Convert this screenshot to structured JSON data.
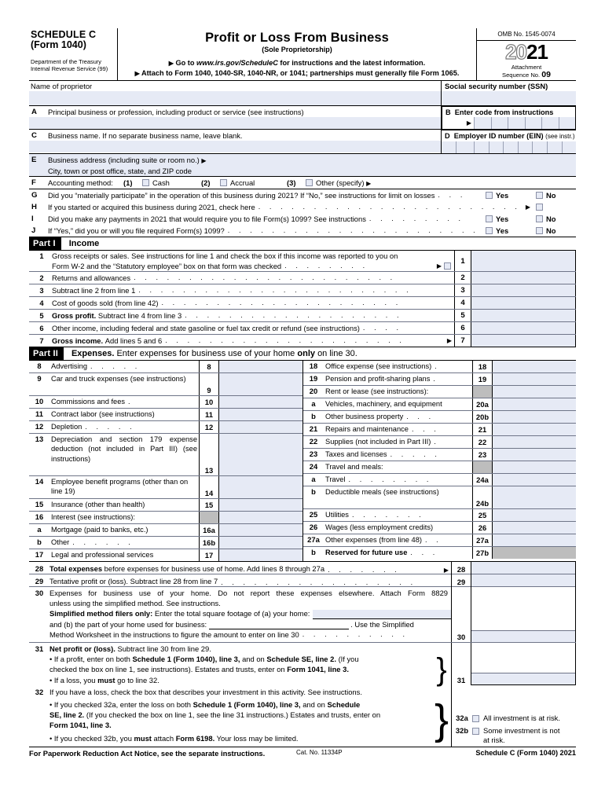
{
  "header": {
    "schedule_line1": "SCHEDULE C",
    "schedule_line2": "(Form 1040)",
    "dept_line1": "Department of the Treasury",
    "dept_line2": "Internal Revenue Service (99)",
    "title": "Profit or Loss From Business",
    "subtitle": "(Sole Proprietorship)",
    "goto_prefix": "Go to",
    "goto_url": "www.irs.gov/ScheduleC",
    "goto_suffix": "for instructions and the latest information.",
    "attach": "Attach to Form 1040, 1040-SR, 1040-NR, or 1041; partnerships must generally file Form 1065.",
    "omb": "OMB No. 1545-0074",
    "year_light": "20",
    "year_bold": "21",
    "attachment_label": "Attachment",
    "sequence_label": "Sequence No.",
    "sequence_no": "09"
  },
  "identity": {
    "name_label": "Name of proprietor",
    "ssn_label": "Social security number (SSN)",
    "a_letter": "A",
    "a_text": "Principal business or profession, including product or service (see instructions)",
    "b_letter": "B",
    "b_text": "Enter code from instructions",
    "c_letter": "C",
    "c_text": "Business name. If no separate business name, leave blank.",
    "d_letter": "D",
    "d_text": "Employer ID number (EIN)",
    "d_text_small": "(see instr.)",
    "e_letter": "E",
    "e_text": "Business address (including suite or room no.)",
    "e_text2": "City, town or post office, state, and ZIP code",
    "f_letter": "F",
    "f_label": "Accounting method:",
    "f_opt1_num": "(1)",
    "f_opt1": "Cash",
    "f_opt2_num": "(2)",
    "f_opt2": "Accrual",
    "f_opt3_num": "(3)",
    "f_opt3": "Other (specify)",
    "g_letter": "G",
    "g_text": "Did you “materially participate” in the operation of this business during 2021? If “No,” see instructions for limit on losses",
    "h_letter": "H",
    "h_text": "If you started or acquired this business during 2021, check here",
    "i_letter": "I",
    "i_text": "Did you make any payments in 2021 that would require you to file Form(s) 1099? See instructions",
    "j_letter": "J",
    "j_text": "If “Yes,” did you or will you file required Form(s) 1099?",
    "yes": "Yes",
    "no": "No"
  },
  "part1": {
    "part_label": "Part I",
    "part_title": "Income",
    "lines": [
      {
        "num": "1",
        "text_a": "Gross receipts or sales. See instructions for line 1 and check the box if this income was reported to you on",
        "text_b": "Form W-2 and the “Statutory employee” box on that form was checked",
        "has_checkbox": true
      },
      {
        "num": "2",
        "text_a": "Returns and allowances"
      },
      {
        "num": "3",
        "text_a": "Subtract line 2 from line 1"
      },
      {
        "num": "4",
        "text_a": "Cost of goods sold (from line 42)"
      },
      {
        "num": "5",
        "text_bold": "Gross profit.",
        "text_a": "Subtract line 4 from line 3"
      },
      {
        "num": "6",
        "text_a": "Other income, including federal and state gasoline or fuel tax credit or refund (see instructions)"
      },
      {
        "num": "7",
        "text_bold": "Gross income.",
        "text_a": "Add lines 5 and 6"
      }
    ]
  },
  "part2": {
    "part_label": "Part II",
    "part_title_bold": "Expenses.",
    "part_title_rest": "Enter expenses for business use of your home",
    "part_title_only": "only",
    "part_title_end": "on line 30.",
    "left": [
      {
        "num": "8",
        "text": "Advertising",
        "box": "8",
        "dots": true
      },
      {
        "num": "9",
        "text": "Car and truck expenses (see instructions)",
        "box": "9",
        "dots": true,
        "tall": true
      },
      {
        "num": "10",
        "text": "Commissions and fees",
        "box": "10",
        "dots": true
      },
      {
        "num": "11",
        "text": "Contract labor (see instructions)",
        "box": "11"
      },
      {
        "num": "12",
        "text": "Depletion",
        "box": "12",
        "dots": true
      },
      {
        "num": "13",
        "text": "Depreciation and section 179 expense deduction (not included in Part III) (see instructions)",
        "box": "13",
        "dots": true,
        "tall": true
      },
      {
        "num": "14",
        "text": "Employee benefit programs (other than on line 19)",
        "box": "14",
        "dots": true,
        "tall": true
      },
      {
        "num": "15",
        "text": "Insurance (other than health)",
        "box": "15"
      },
      {
        "num": "16",
        "text": "Interest (see instructions):",
        "box": "",
        "gray": true
      },
      {
        "num": "a",
        "text": "Mortgage (paid to banks, etc.)",
        "box": "16a"
      },
      {
        "num": "b",
        "text": "Other",
        "box": "16b",
        "dots": true
      },
      {
        "num": "17",
        "text": "Legal and professional services",
        "box": "17"
      }
    ],
    "right": [
      {
        "num": "18",
        "text": "Office expense (see instructions)",
        "box": "18",
        "dots": true
      },
      {
        "num": "19",
        "text": "Pension and profit-sharing plans",
        "box": "19",
        "dots": true
      },
      {
        "num": "20",
        "text": "Rent or lease (see instructions):",
        "box": "",
        "gray": true
      },
      {
        "num": "a",
        "text": "Vehicles, machinery, and equipment",
        "box": "20a"
      },
      {
        "num": "b",
        "text": "Other business property",
        "box": "20b",
        "dots": true
      },
      {
        "num": "21",
        "text": "Repairs and maintenance",
        "box": "21",
        "dots": true
      },
      {
        "num": "22",
        "text": "Supplies (not included in Part III)",
        "box": "22",
        "dots": true
      },
      {
        "num": "23",
        "text": "Taxes and licenses",
        "box": "23",
        "dots": true
      },
      {
        "num": "24",
        "text": "Travel and meals:",
        "box": "",
        "gray": true
      },
      {
        "num": "a",
        "text": "Travel",
        "box": "24a",
        "dots": true
      },
      {
        "num": "b",
        "text": "Deductible meals (see instructions)",
        "box": "24b",
        "dots": true,
        "tall": true
      },
      {
        "num": "25",
        "text": "Utilities",
        "box": "25",
        "dots": true
      },
      {
        "num": "26",
        "text": "Wages (less employment credits)",
        "box": "26"
      },
      {
        "num": "27a",
        "text": "Other expenses (from line 48)",
        "box": "27a",
        "dots": true
      },
      {
        "num": "b",
        "text": "Reserved for future use",
        "box": "27b",
        "dots": true,
        "bold": true,
        "gray_amt": true
      }
    ]
  },
  "lines28_32": {
    "l28_num": "28",
    "l28_bold": "Total expenses",
    "l28_text": "before expenses for business use of home. Add lines 8 through 27a",
    "l28_box": "28",
    "l29_num": "29",
    "l29_text": "Tentative profit or (loss). Subtract line 28 from line 7",
    "l29_box": "29",
    "l30_num": "30",
    "l30_text_a": "Expenses for business use of your home. Do not report these expenses elsewhere. Attach Form 8829",
    "l30_text_b": "unless using the simplified method. See instructions.",
    "l30_simplified_bold": "Simplified method filers only:",
    "l30_simplified_rest": "Enter the total square footage of (a) your home:",
    "l30_b_text": "and (b) the part of your home used for business:",
    "l30_b_tail": ". Use the Simplified",
    "l30_text_c": "Method Worksheet in the instructions to figure the amount to enter on line 30",
    "l30_box": "30",
    "l31_num": "31",
    "l31_bold": "Net profit or (loss).",
    "l31_text": "Subtract line 30 from line 29.",
    "l31_b1_a": "• If a profit, enter on both",
    "l31_b1_b": "Schedule 1 (Form 1040), line 3,",
    "l31_b1_c": "and on",
    "l31_b1_d": "Schedule SE, line 2.",
    "l31_b1_e": "(If you",
    "l31_b2_a": "checked the box on line 1, see instructions). Estates and trusts, enter on",
    "l31_b2_b": "Form 1041, line 3.",
    "l31_b3_a": "• If a loss, you",
    "l31_b3_b": "must",
    "l31_b3_c": "go to line 32.",
    "l31_box": "31",
    "l32_num": "32",
    "l32_text": "If you have a loss, check the box that describes your investment in this activity. See instructions.",
    "l32_b1_a": "• If you checked 32a, enter the loss on both",
    "l32_b1_b": "Schedule 1 (Form 1040), line 3,",
    "l32_b1_c": "and on",
    "l32_b1_d": "Schedule",
    "l32_b2_a": "SE, line 2.",
    "l32_b2_b": "(If you checked the box on line 1, see the line 31 instructions.) Estates and trusts, enter on",
    "l32_b3_a": "Form 1041, line 3.",
    "l32_b4_a": "• If you checked 32b, you",
    "l32_b4_b": "must",
    "l32_b4_c": "attach",
    "l32_b4_d": "Form 6198.",
    "l32_b4_e": "Your loss may be limited.",
    "l32a_box": "32a",
    "l32a_text": "All investment is at risk.",
    "l32b_box": "32b",
    "l32b_text_a": "Some investment is not",
    "l32b_text_b": "at risk."
  },
  "footer": {
    "paperwork": "For Paperwork Reduction Act Notice, see the separate instructions.",
    "cat": "Cat. No. 11334P",
    "schedule": "Schedule C (Form 1040) 2021"
  },
  "colors": {
    "field_shade": "#e6eaf5",
    "gray_block": "#bdbdbd",
    "rule": "#000000"
  }
}
